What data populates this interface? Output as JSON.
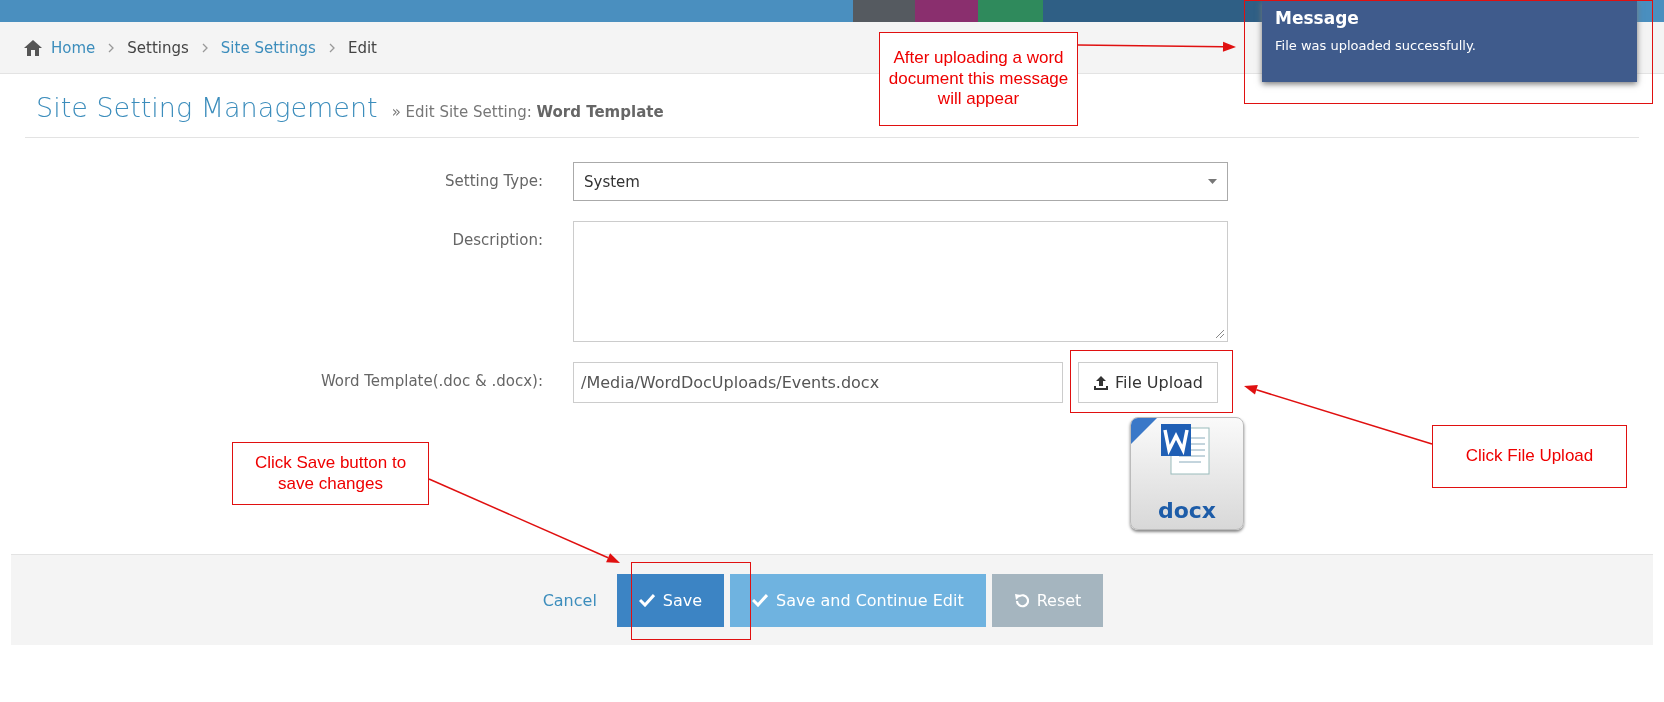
{
  "breadcrumb": [
    {
      "label": "Home",
      "kind": "link"
    },
    {
      "label": "Settings",
      "kind": "text"
    },
    {
      "label": "Site Settings",
      "kind": "link"
    },
    {
      "label": "Edit",
      "kind": "text"
    }
  ],
  "page": {
    "title": "Site Setting Management",
    "subtitle_prefix": "» Edit Site Setting:",
    "subtitle_name": "Word Template"
  },
  "form": [
    {
      "label": "Setting Type:",
      "kind": "select",
      "value": "System"
    },
    {
      "label": "Description:",
      "kind": "textarea"
    },
    {
      "label": "Word Template(.doc & .docx):",
      "kind": "file",
      "value": "/Media/WordDocUploads/Events.docx",
      "button": "File Upload",
      "file_badge": "docx"
    }
  ],
  "actions": [
    {
      "label": "Cancel",
      "kind": "link"
    },
    {
      "label": "Save",
      "kind": "primary"
    },
    {
      "label": "Save and Continue Edit",
      "kind": "secondary"
    },
    {
      "label": "Reset",
      "kind": "reset"
    }
  ],
  "toast": {
    "title": "Message",
    "text": "File was uploaded successfully."
  },
  "annotations": [
    "After uploading a word document this message will appear",
    "Click Save button to save changes",
    "Click File Upload"
  ]
}
